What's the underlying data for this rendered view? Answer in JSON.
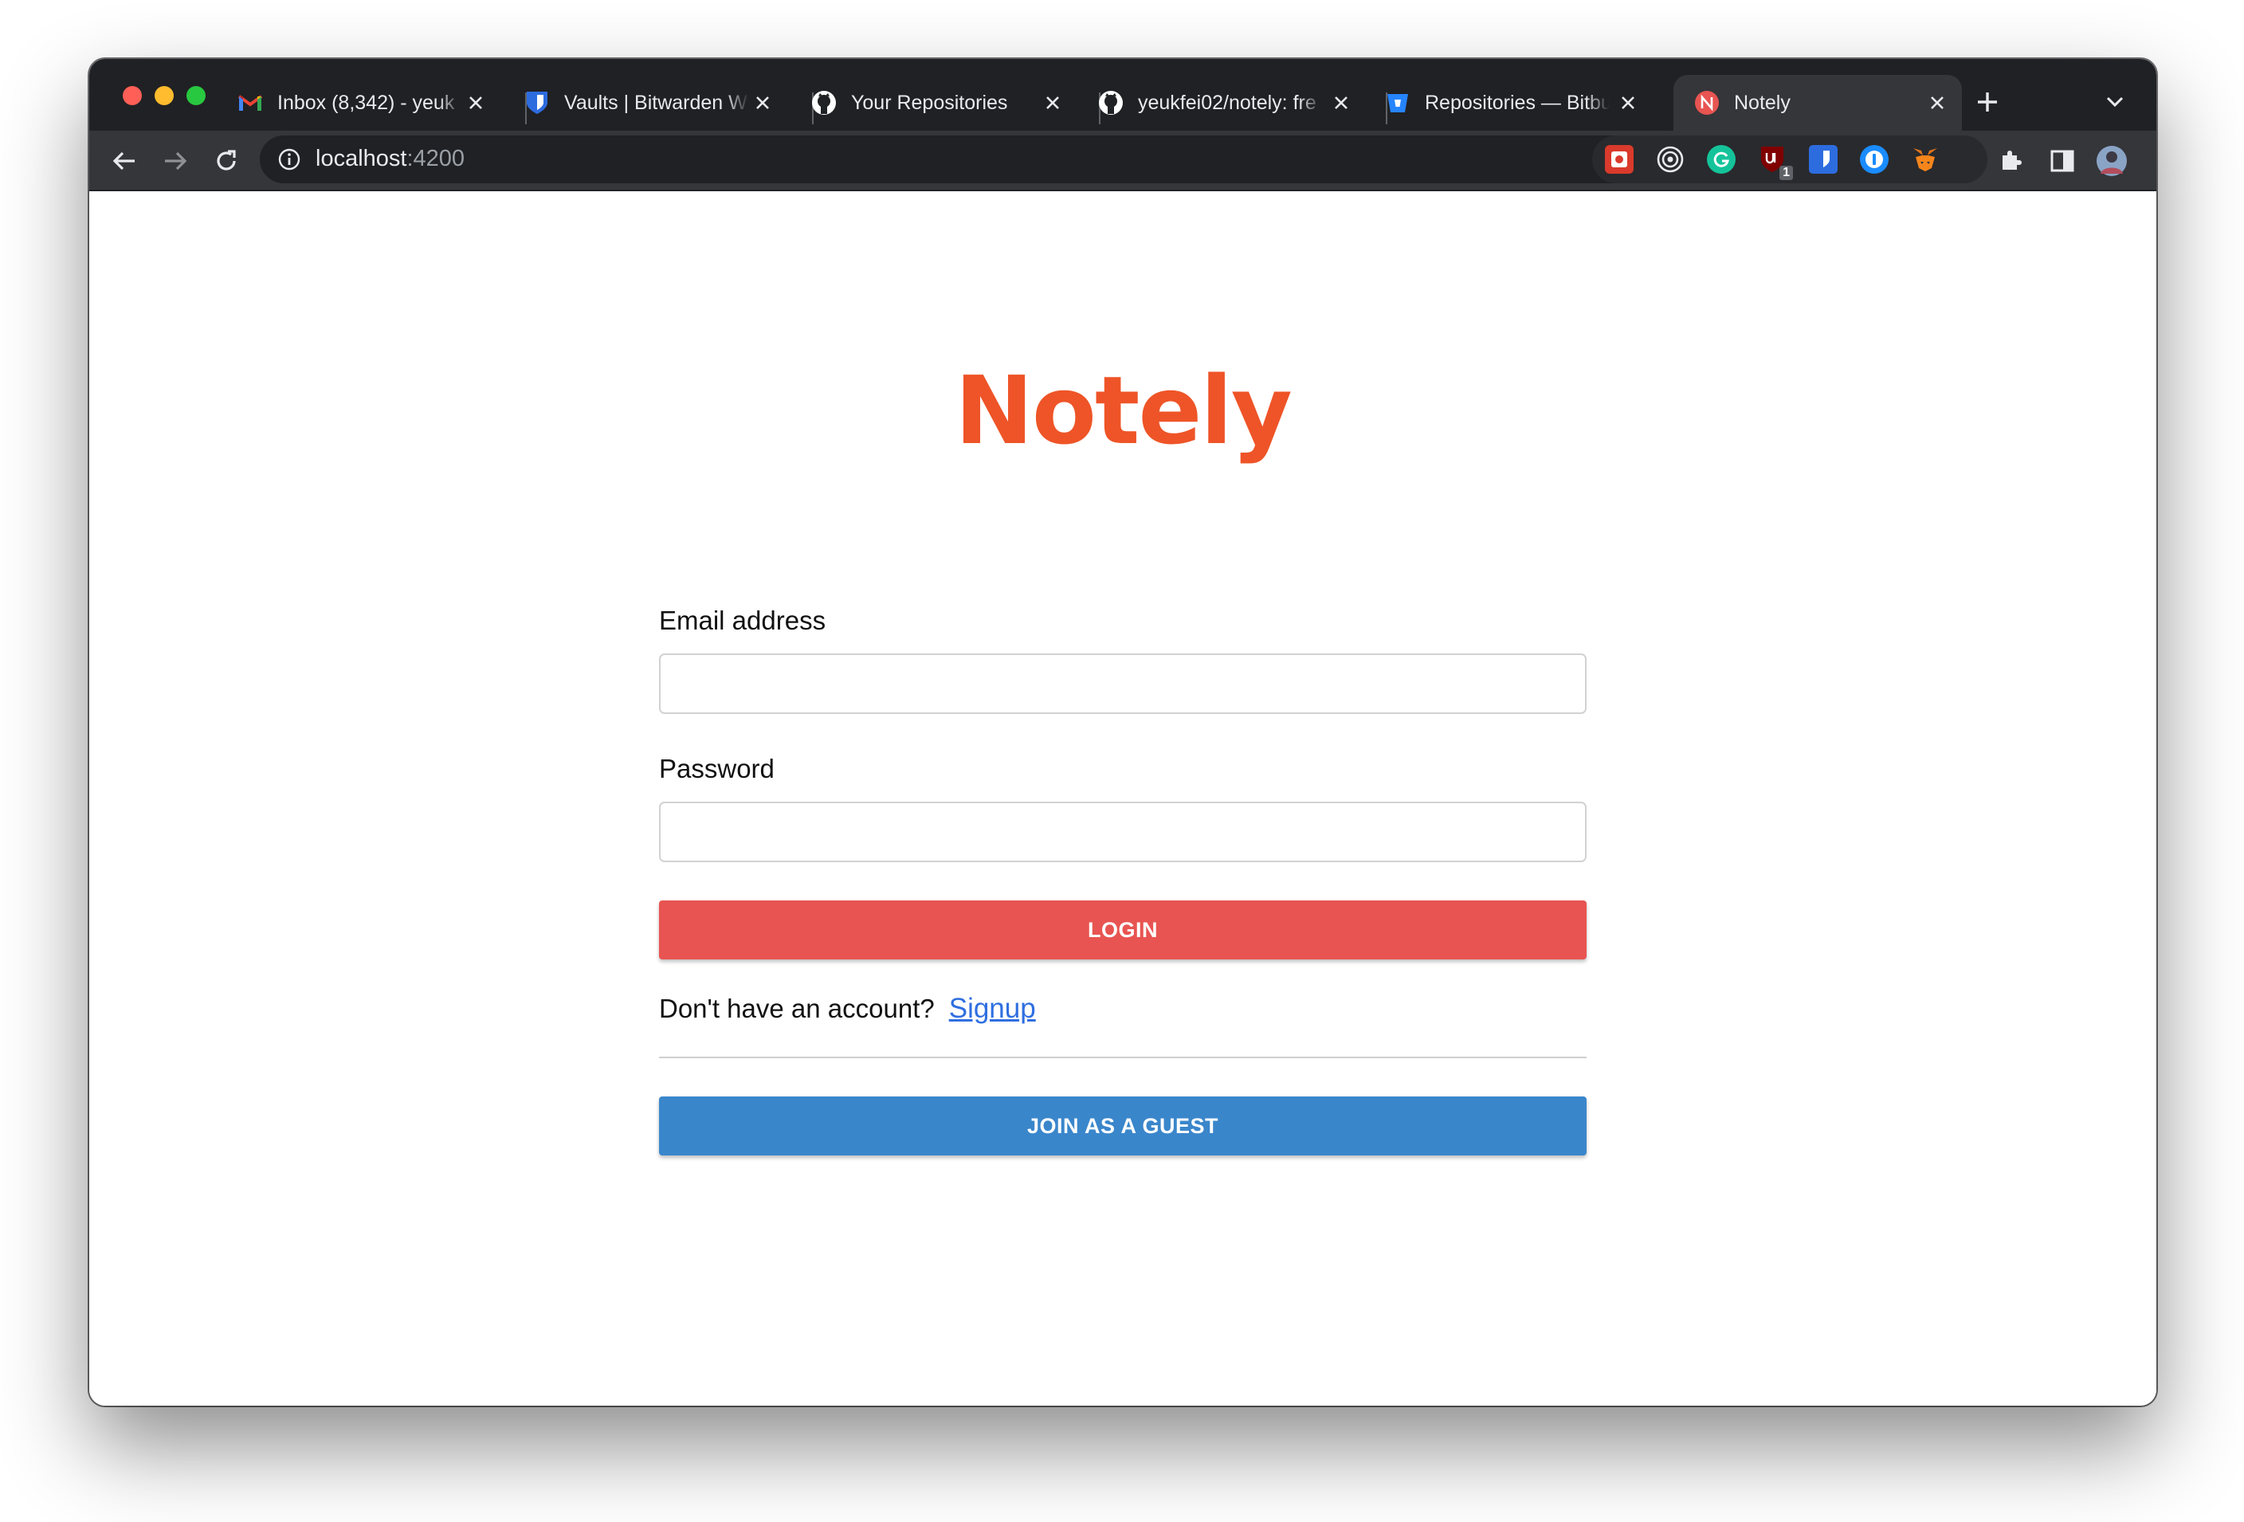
{
  "browser": {
    "tabs": [
      {
        "label": "Inbox (8,342) - yeuk",
        "icon": "gmail-icon",
        "active": false
      },
      {
        "label": "Vaults | Bitwarden W",
        "icon": "bitwarden-icon",
        "active": false
      },
      {
        "label": "Your Repositories",
        "icon": "github-icon",
        "active": false
      },
      {
        "label": "yeukfei02/notely: fre",
        "icon": "github-icon",
        "active": false
      },
      {
        "label": "Repositories — Bitbu",
        "icon": "bitbucket-icon",
        "active": false
      },
      {
        "label": "Notely",
        "icon": "notely-favicon",
        "active": true
      }
    ],
    "address": {
      "host": "localhost",
      "port": ":4200"
    },
    "extensions": [
      "ext-red-icon",
      "ext-target-icon",
      "grammarly-icon",
      "ublock-icon",
      "bitwarden-icon",
      "onepassword-icon",
      "metamask-icon"
    ],
    "ublock_badge": "1"
  },
  "page": {
    "logo": "Notely",
    "email_label": "Email address",
    "email_value": "",
    "password_label": "Password",
    "password_value": "",
    "login_label": "LOGIN",
    "signup_prompt": "Don't have an account?",
    "signup_link": "Signup",
    "guest_label": "JOIN AS A GUEST"
  },
  "colors": {
    "logo": "#ee5427",
    "login_button": "#e85451",
    "guest_button": "#3a86cb",
    "link": "#2f6fe0"
  }
}
